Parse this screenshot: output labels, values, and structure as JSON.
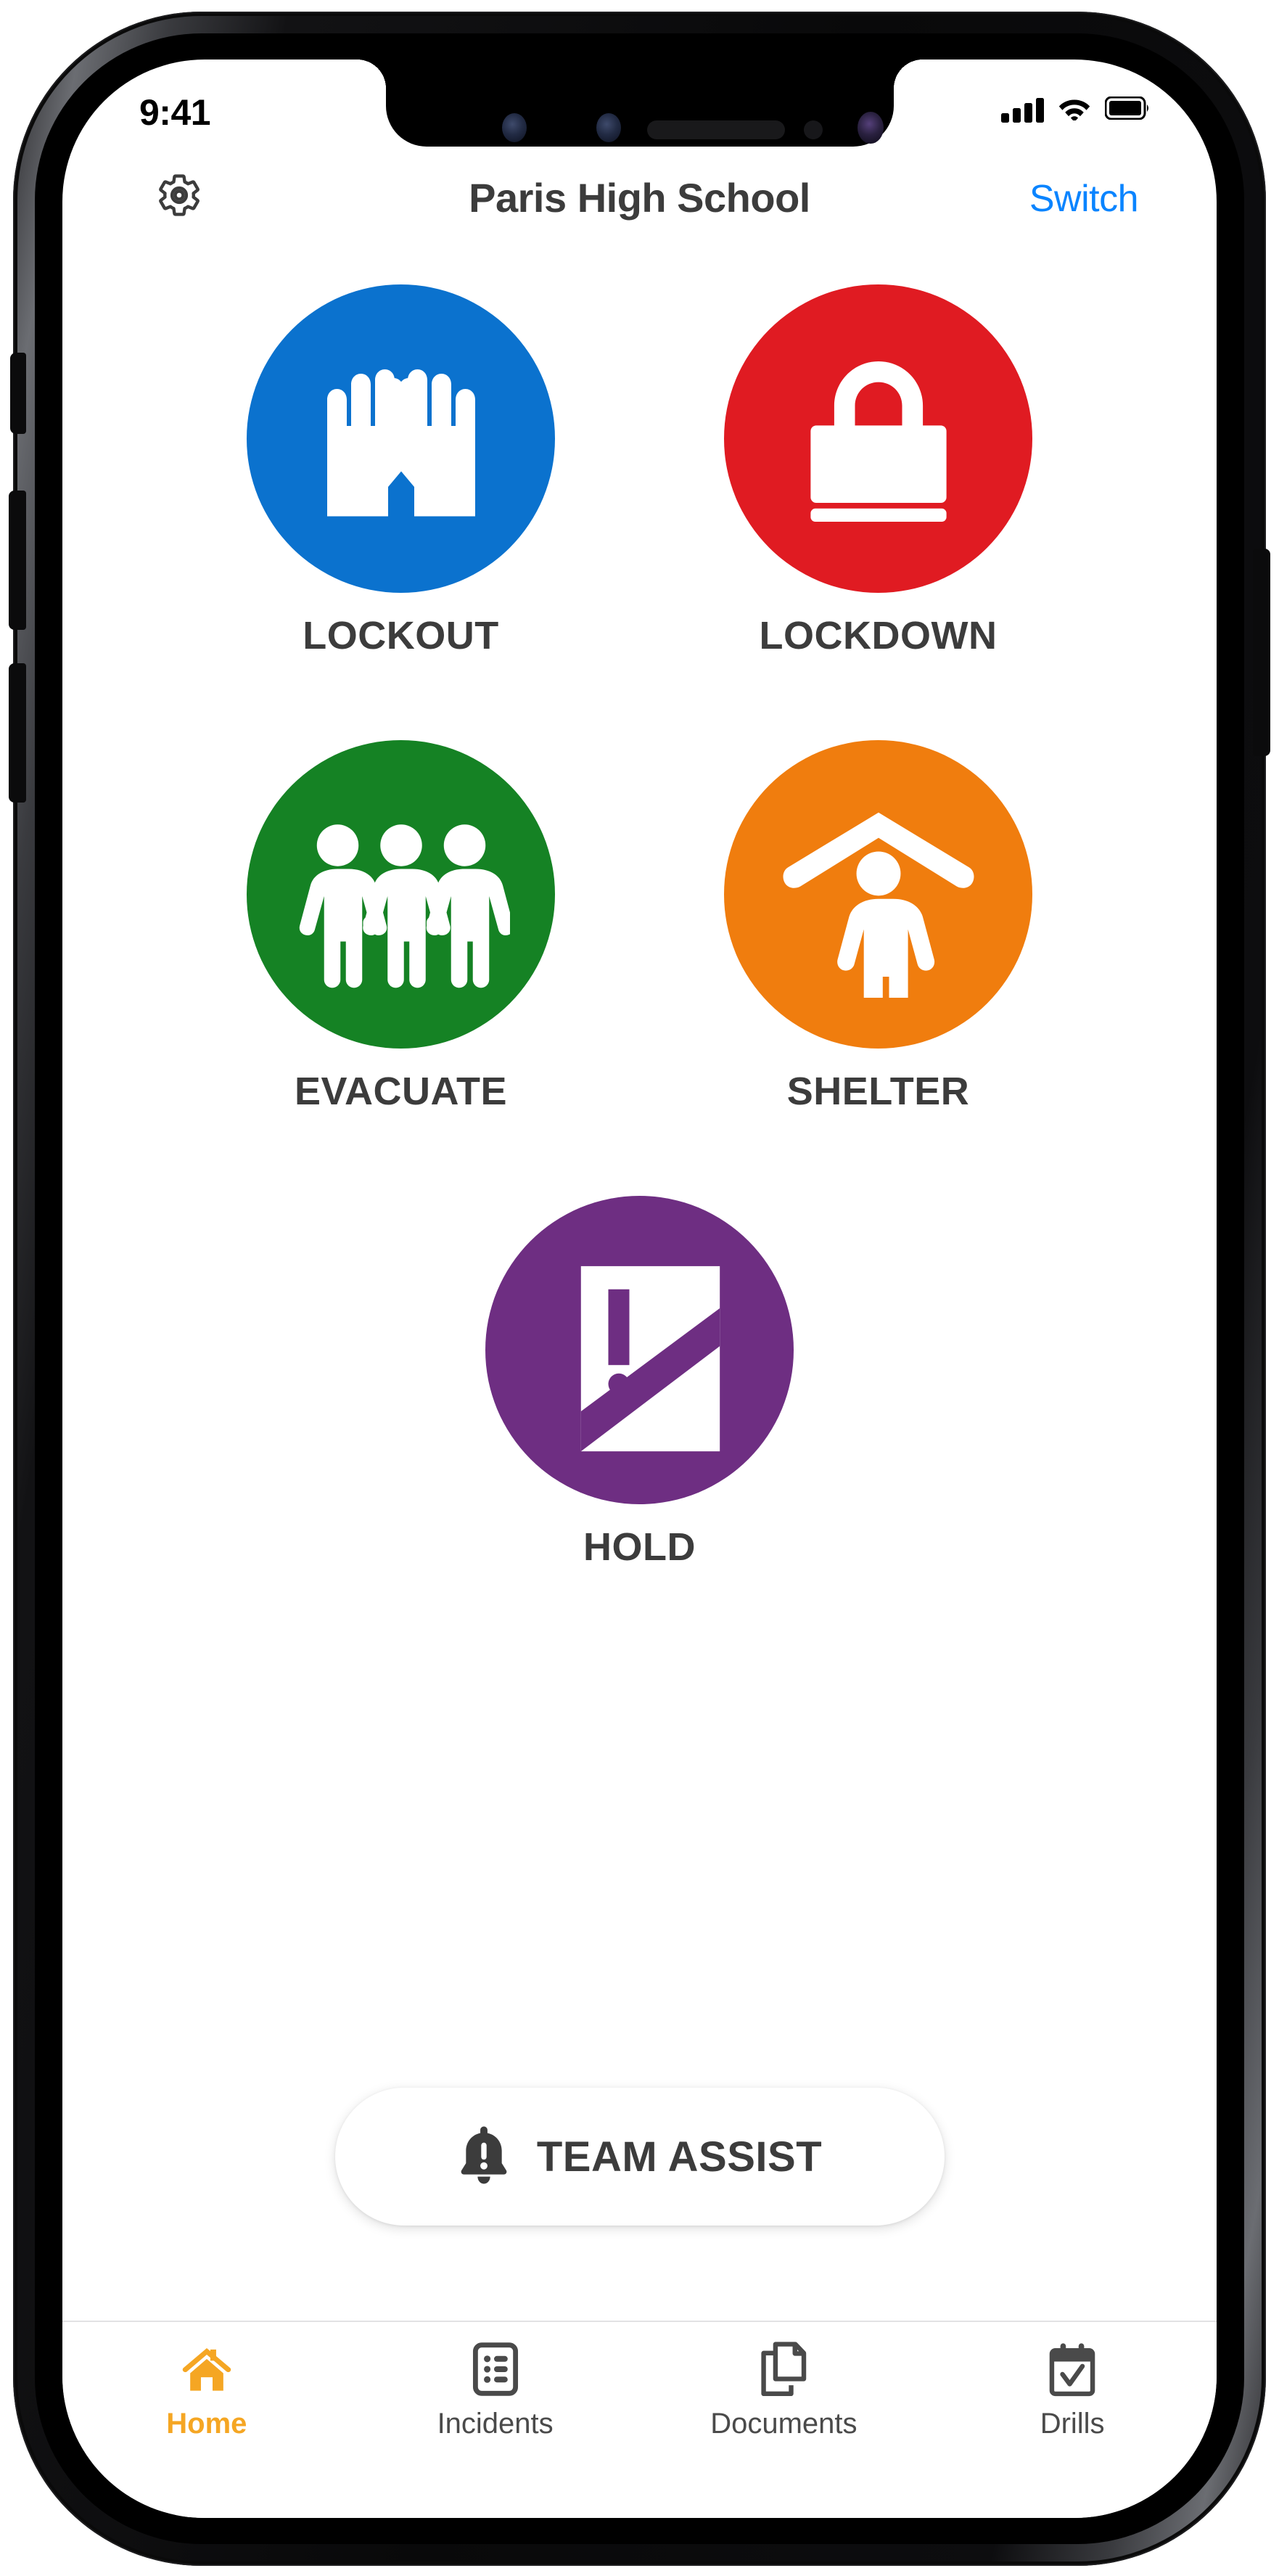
{
  "status_bar": {
    "time": "9:41",
    "signal_icon": "cellular-signal-icon",
    "wifi_icon": "wifi-icon",
    "battery_icon": "battery-full-icon"
  },
  "header": {
    "settings_icon": "gear-icon",
    "title": "Paris High School",
    "switch_label": "Switch"
  },
  "actions": [
    {
      "id": "lockout",
      "label": "LOCKOUT",
      "color": "#0B72CE",
      "icon": "two-hands-icon"
    },
    {
      "id": "lockdown",
      "label": "LOCKDOWN",
      "color": "#E01B22",
      "icon": "padlock-icon"
    },
    {
      "id": "evacuate",
      "label": "EVACUATE",
      "color": "#158224",
      "icon": "three-people-holding-hands-icon"
    },
    {
      "id": "shelter",
      "label": "SHELTER",
      "color": "#F07D0E",
      "icon": "person-under-roof-icon"
    },
    {
      "id": "hold",
      "label": "HOLD",
      "color": "#6E2E82",
      "icon": "door-with-exclamation-icon"
    }
  ],
  "team_assist": {
    "label": "TEAM ASSIST",
    "icon": "bell-alert-icon"
  },
  "tab_bar": {
    "active_color": "#F5A623",
    "inactive_color": "#4A4A4A",
    "items": [
      {
        "id": "home",
        "label": "Home",
        "icon": "home-icon",
        "active": true
      },
      {
        "id": "incidents",
        "label": "Incidents",
        "icon": "list-icon",
        "active": false
      },
      {
        "id": "documents",
        "label": "Documents",
        "icon": "documents-icon",
        "active": false
      },
      {
        "id": "drills",
        "label": "Drills",
        "icon": "calendar-check-icon",
        "active": false
      }
    ]
  }
}
